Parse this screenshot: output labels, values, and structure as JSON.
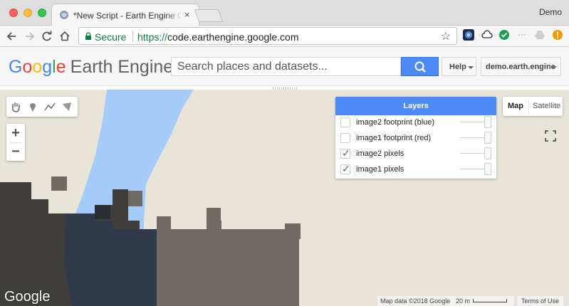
{
  "browser": {
    "tab_title": "*New Script - Earth Engine Co",
    "tab_close": "×",
    "profile_name": "Demo",
    "secure_label": "Secure",
    "url_scheme": "https://",
    "url_host": "code.earthengine.google.com",
    "star": "☆"
  },
  "header": {
    "logo_letters": [
      "G",
      "o",
      "o",
      "g",
      "l",
      "e"
    ],
    "logo_product": "Earth Engine",
    "search_placeholder": "Search places and datasets...",
    "help_label": "Help",
    "account_label": "demo.earth.engine"
  },
  "map": {
    "zoom_in": "+",
    "zoom_out": "−",
    "layers_title": "Layers",
    "layers": [
      {
        "label": "image2 footprint (blue)",
        "checked": false,
        "tick": ""
      },
      {
        "label": "image1 footprint (red)",
        "checked": false,
        "tick": ""
      },
      {
        "label": "image2 pixels",
        "checked": true,
        "tick": "✓"
      },
      {
        "label": "image1 pixels",
        "checked": true,
        "tick": "✓"
      }
    ],
    "map_type": {
      "map": "Map",
      "satellite": "Satellite",
      "selected": "Map"
    },
    "watermark": "Google",
    "attribution": "Map data ©2018 Google",
    "scale_label": "20 m",
    "terms": "Terms of Use",
    "colors": {
      "background": "#e8e5d8",
      "water": "#a4cbfa",
      "pixels_dark": "#3f3e3b",
      "pixels_mid": "#6f6b64",
      "overlap": "#2f3a4c"
    }
  }
}
